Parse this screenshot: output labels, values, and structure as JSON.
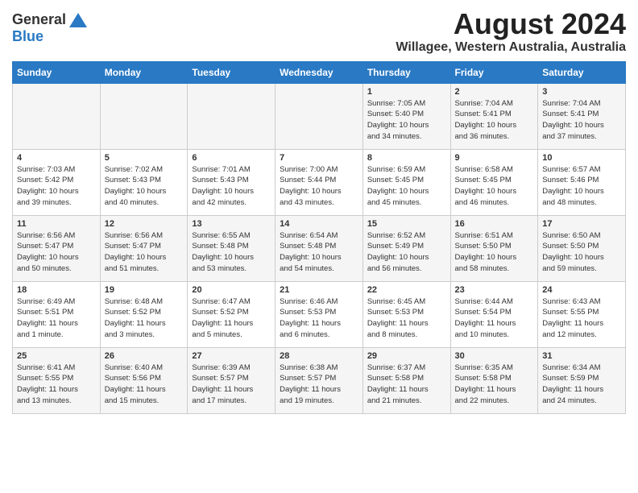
{
  "header": {
    "logo_general": "General",
    "logo_blue": "Blue",
    "main_title": "August 2024",
    "subtitle": "Willagee, Western Australia, Australia"
  },
  "calendar": {
    "days_of_week": [
      "Sunday",
      "Monday",
      "Tuesday",
      "Wednesday",
      "Thursday",
      "Friday",
      "Saturday"
    ],
    "weeks": [
      [
        {
          "day": "",
          "info": ""
        },
        {
          "day": "",
          "info": ""
        },
        {
          "day": "",
          "info": ""
        },
        {
          "day": "",
          "info": ""
        },
        {
          "day": "1",
          "info": "Sunrise: 7:05 AM\nSunset: 5:40 PM\nDaylight: 10 hours\nand 34 minutes."
        },
        {
          "day": "2",
          "info": "Sunrise: 7:04 AM\nSunset: 5:41 PM\nDaylight: 10 hours\nand 36 minutes."
        },
        {
          "day": "3",
          "info": "Sunrise: 7:04 AM\nSunset: 5:41 PM\nDaylight: 10 hours\nand 37 minutes."
        }
      ],
      [
        {
          "day": "4",
          "info": "Sunrise: 7:03 AM\nSunset: 5:42 PM\nDaylight: 10 hours\nand 39 minutes."
        },
        {
          "day": "5",
          "info": "Sunrise: 7:02 AM\nSunset: 5:43 PM\nDaylight: 10 hours\nand 40 minutes."
        },
        {
          "day": "6",
          "info": "Sunrise: 7:01 AM\nSunset: 5:43 PM\nDaylight: 10 hours\nand 42 minutes."
        },
        {
          "day": "7",
          "info": "Sunrise: 7:00 AM\nSunset: 5:44 PM\nDaylight: 10 hours\nand 43 minutes."
        },
        {
          "day": "8",
          "info": "Sunrise: 6:59 AM\nSunset: 5:45 PM\nDaylight: 10 hours\nand 45 minutes."
        },
        {
          "day": "9",
          "info": "Sunrise: 6:58 AM\nSunset: 5:45 PM\nDaylight: 10 hours\nand 46 minutes."
        },
        {
          "day": "10",
          "info": "Sunrise: 6:57 AM\nSunset: 5:46 PM\nDaylight: 10 hours\nand 48 minutes."
        }
      ],
      [
        {
          "day": "11",
          "info": "Sunrise: 6:56 AM\nSunset: 5:47 PM\nDaylight: 10 hours\nand 50 minutes."
        },
        {
          "day": "12",
          "info": "Sunrise: 6:56 AM\nSunset: 5:47 PM\nDaylight: 10 hours\nand 51 minutes."
        },
        {
          "day": "13",
          "info": "Sunrise: 6:55 AM\nSunset: 5:48 PM\nDaylight: 10 hours\nand 53 minutes."
        },
        {
          "day": "14",
          "info": "Sunrise: 6:54 AM\nSunset: 5:48 PM\nDaylight: 10 hours\nand 54 minutes."
        },
        {
          "day": "15",
          "info": "Sunrise: 6:52 AM\nSunset: 5:49 PM\nDaylight: 10 hours\nand 56 minutes."
        },
        {
          "day": "16",
          "info": "Sunrise: 6:51 AM\nSunset: 5:50 PM\nDaylight: 10 hours\nand 58 minutes."
        },
        {
          "day": "17",
          "info": "Sunrise: 6:50 AM\nSunset: 5:50 PM\nDaylight: 10 hours\nand 59 minutes."
        }
      ],
      [
        {
          "day": "18",
          "info": "Sunrise: 6:49 AM\nSunset: 5:51 PM\nDaylight: 11 hours\nand 1 minute."
        },
        {
          "day": "19",
          "info": "Sunrise: 6:48 AM\nSunset: 5:52 PM\nDaylight: 11 hours\nand 3 minutes."
        },
        {
          "day": "20",
          "info": "Sunrise: 6:47 AM\nSunset: 5:52 PM\nDaylight: 11 hours\nand 5 minutes."
        },
        {
          "day": "21",
          "info": "Sunrise: 6:46 AM\nSunset: 5:53 PM\nDaylight: 11 hours\nand 6 minutes."
        },
        {
          "day": "22",
          "info": "Sunrise: 6:45 AM\nSunset: 5:53 PM\nDaylight: 11 hours\nand 8 minutes."
        },
        {
          "day": "23",
          "info": "Sunrise: 6:44 AM\nSunset: 5:54 PM\nDaylight: 11 hours\nand 10 minutes."
        },
        {
          "day": "24",
          "info": "Sunrise: 6:43 AM\nSunset: 5:55 PM\nDaylight: 11 hours\nand 12 minutes."
        }
      ],
      [
        {
          "day": "25",
          "info": "Sunrise: 6:41 AM\nSunset: 5:55 PM\nDaylight: 11 hours\nand 13 minutes."
        },
        {
          "day": "26",
          "info": "Sunrise: 6:40 AM\nSunset: 5:56 PM\nDaylight: 11 hours\nand 15 minutes."
        },
        {
          "day": "27",
          "info": "Sunrise: 6:39 AM\nSunset: 5:57 PM\nDaylight: 11 hours\nand 17 minutes."
        },
        {
          "day": "28",
          "info": "Sunrise: 6:38 AM\nSunset: 5:57 PM\nDaylight: 11 hours\nand 19 minutes."
        },
        {
          "day": "29",
          "info": "Sunrise: 6:37 AM\nSunset: 5:58 PM\nDaylight: 11 hours\nand 21 minutes."
        },
        {
          "day": "30",
          "info": "Sunrise: 6:35 AM\nSunset: 5:58 PM\nDaylight: 11 hours\nand 22 minutes."
        },
        {
          "day": "31",
          "info": "Sunrise: 6:34 AM\nSunset: 5:59 PM\nDaylight: 11 hours\nand 24 minutes."
        }
      ]
    ]
  }
}
